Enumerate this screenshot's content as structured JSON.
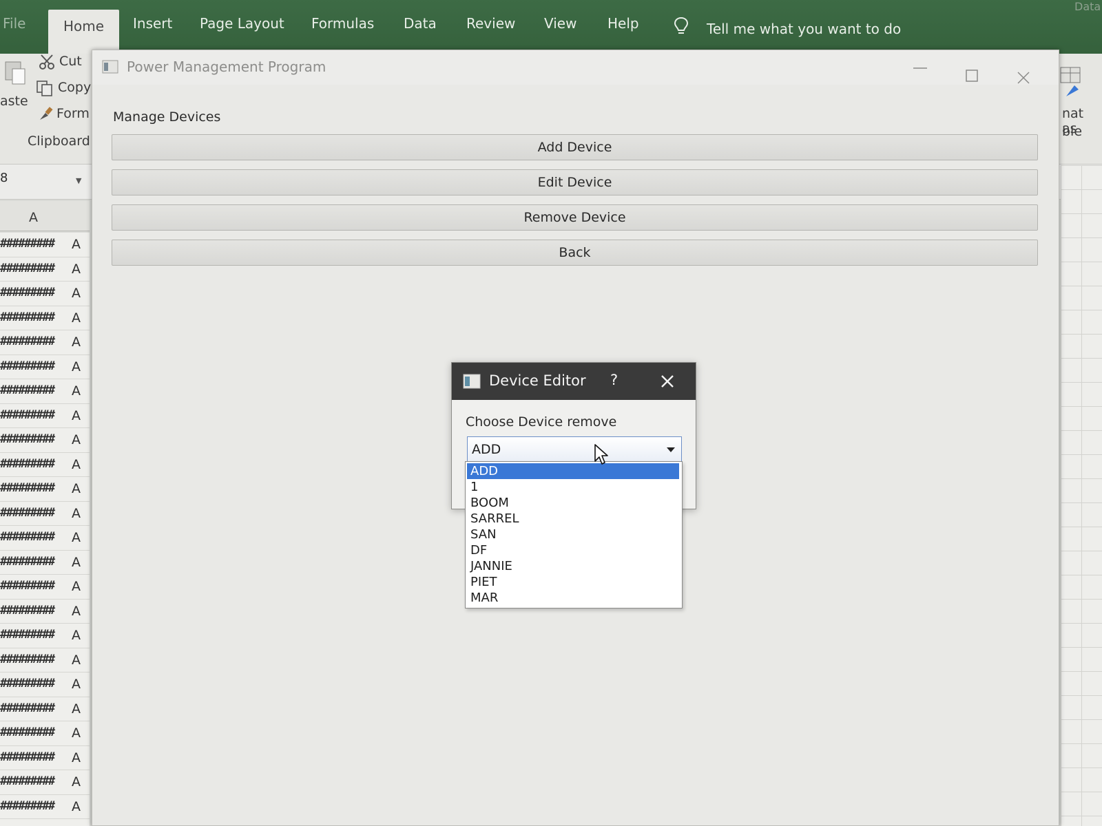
{
  "excel": {
    "tabs": [
      {
        "label": "File"
      },
      {
        "label": "Home"
      },
      {
        "label": "Insert"
      },
      {
        "label": "Page Layout"
      },
      {
        "label": "Formulas"
      },
      {
        "label": "Data"
      },
      {
        "label": "Review"
      },
      {
        "label": "View"
      },
      {
        "label": "Help"
      }
    ],
    "tell_me": "Tell me what you want to do",
    "corner_label": "Data",
    "clipboard": {
      "cut": "Cut",
      "copy": "Copy",
      "format": "Form",
      "paste": "aste",
      "group": "Clipboard"
    },
    "format_as_table_1": "nat as",
    "format_as_table_2": "ble",
    "name_box": "8",
    "column_header": "A",
    "cell_value": "#########",
    "col_b_value": "A"
  },
  "window": {
    "title": "Power Management Program",
    "heading": "Manage Devices",
    "buttons": {
      "add": "Add Device",
      "edit": "Edit Device",
      "remove": "Remove Device",
      "back": "Back"
    }
  },
  "dialog": {
    "title": "Device Editor",
    "help": "?",
    "label": "Choose Device remove",
    "selected": "ADD",
    "options": [
      "ADD",
      "1",
      "BOOM",
      "SARREL",
      "SAN",
      "DF",
      "JANNIE",
      "PIET",
      "MAR"
    ]
  },
  "colors": {
    "excel_green": "#3d6b45",
    "dialog_titlebar": "#3a3a3a",
    "selection": "#3a78d6"
  },
  "icons": {
    "cut": "scissors-icon",
    "copy": "copy-icon",
    "format_painter": "brush-icon",
    "tell_me": "lightbulb-icon",
    "close": "close-icon",
    "minimize": "minimize-icon",
    "maximize": "maximize-icon",
    "dropdown": "chevron-down-icon",
    "cursor": "mouse-pointer-icon"
  }
}
